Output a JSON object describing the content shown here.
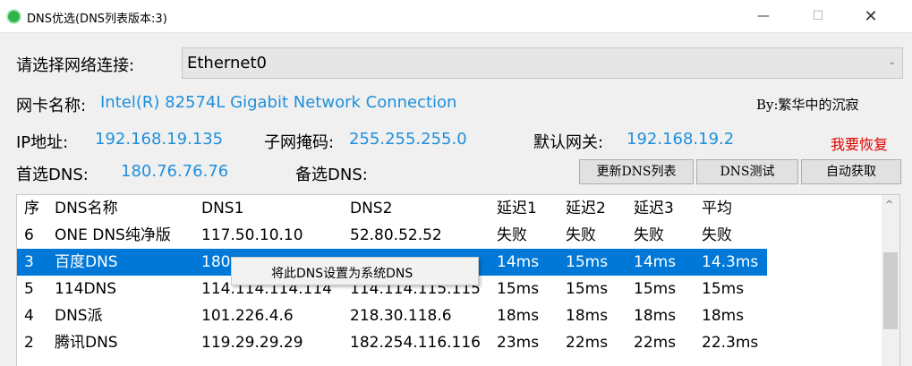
{
  "window": {
    "title": "DNS优选(DNS列表版本:3)",
    "min_glyph": "—",
    "max_glyph": "☐",
    "close_glyph": "✕"
  },
  "network": {
    "label": "请选择网络连接:",
    "selected": "Ethernet0",
    "arrow": "⌄"
  },
  "nic": {
    "label": "网卡名称:",
    "value": "Intel(R) 82574L Gigabit Network Connection",
    "author": "By:繁华中的沉寂"
  },
  "ip": {
    "ip_label": "IP地址:",
    "ip_value": "192.168.19.135",
    "mask_label": "子网掩码:",
    "mask_value": "255.255.255.0",
    "gw_label": "默认网关:",
    "gw_value": "192.168.19.2",
    "restore": "我要恢复"
  },
  "dns": {
    "primary_label": "首选DNS:",
    "primary_value": "180.76.76.76",
    "secondary_label": "备选DNS:",
    "update_btn": "更新DNS列表",
    "test_btn": "DNS测试",
    "auto_btn": "自动获取"
  },
  "table": {
    "columns": [
      "序",
      "DNS名称",
      "DNS1",
      "DNS2",
      "延迟1",
      "延迟2",
      "延迟3",
      "平均"
    ],
    "rows": [
      [
        "6",
        "ONE DNS纯净版",
        "117.50.10.10",
        "52.80.52.52",
        "失败",
        "失败",
        "失败",
        "失败"
      ],
      [
        "3",
        "百度DNS",
        "180",
        "",
        "14ms",
        "15ms",
        "14ms",
        "14.3ms"
      ],
      [
        "5",
        "114DNS",
        "114.114.114.114",
        "114.114.115.115",
        "15ms",
        "15ms",
        "15ms",
        "15ms"
      ],
      [
        "4",
        "DNS派",
        "101.226.4.6",
        "218.30.118.6",
        "18ms",
        "18ms",
        "18ms",
        "18ms"
      ],
      [
        "2",
        "腾讯DNS",
        "119.29.29.29",
        "182.254.116.116",
        "23ms",
        "22ms",
        "22ms",
        "22.3ms"
      ]
    ],
    "selected_row": 1,
    "scroll_up_glyph": "^"
  },
  "context_menu": {
    "item": "将此DNS设置为系统DNS"
  },
  "colors": {
    "value_blue": "#1e8fdb",
    "restore_red": "#e00000",
    "selection": "#0078d7"
  }
}
